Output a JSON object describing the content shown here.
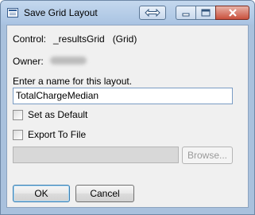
{
  "window": {
    "title": "Save Grid Layout",
    "title_icon": "grid-app-icon",
    "controls": {
      "swap_icon": "swap-arrows-icon",
      "minimize_icon": "minimize-icon",
      "maximize_icon": "maximize-icon",
      "close_icon": "close-icon"
    }
  },
  "form": {
    "control_label": "Control:",
    "control_value": "_resultsGrid   (Grid)",
    "owner_label": "Owner:",
    "name_prompt": "Enter a name for this layout.",
    "name_value": "TotalChargeMedian",
    "set_default_label": "Set as Default",
    "set_default_checked": false,
    "export_label": "Export To File",
    "export_checked": false,
    "export_path_value": "",
    "browse_label": "Browse..."
  },
  "actions": {
    "ok_label": "OK",
    "cancel_label": "Cancel"
  },
  "colors": {
    "frame": "#a9c1dd",
    "client": "#f0f0f0",
    "close_button": "#c9503c",
    "input_border": "#7a9cc4"
  }
}
